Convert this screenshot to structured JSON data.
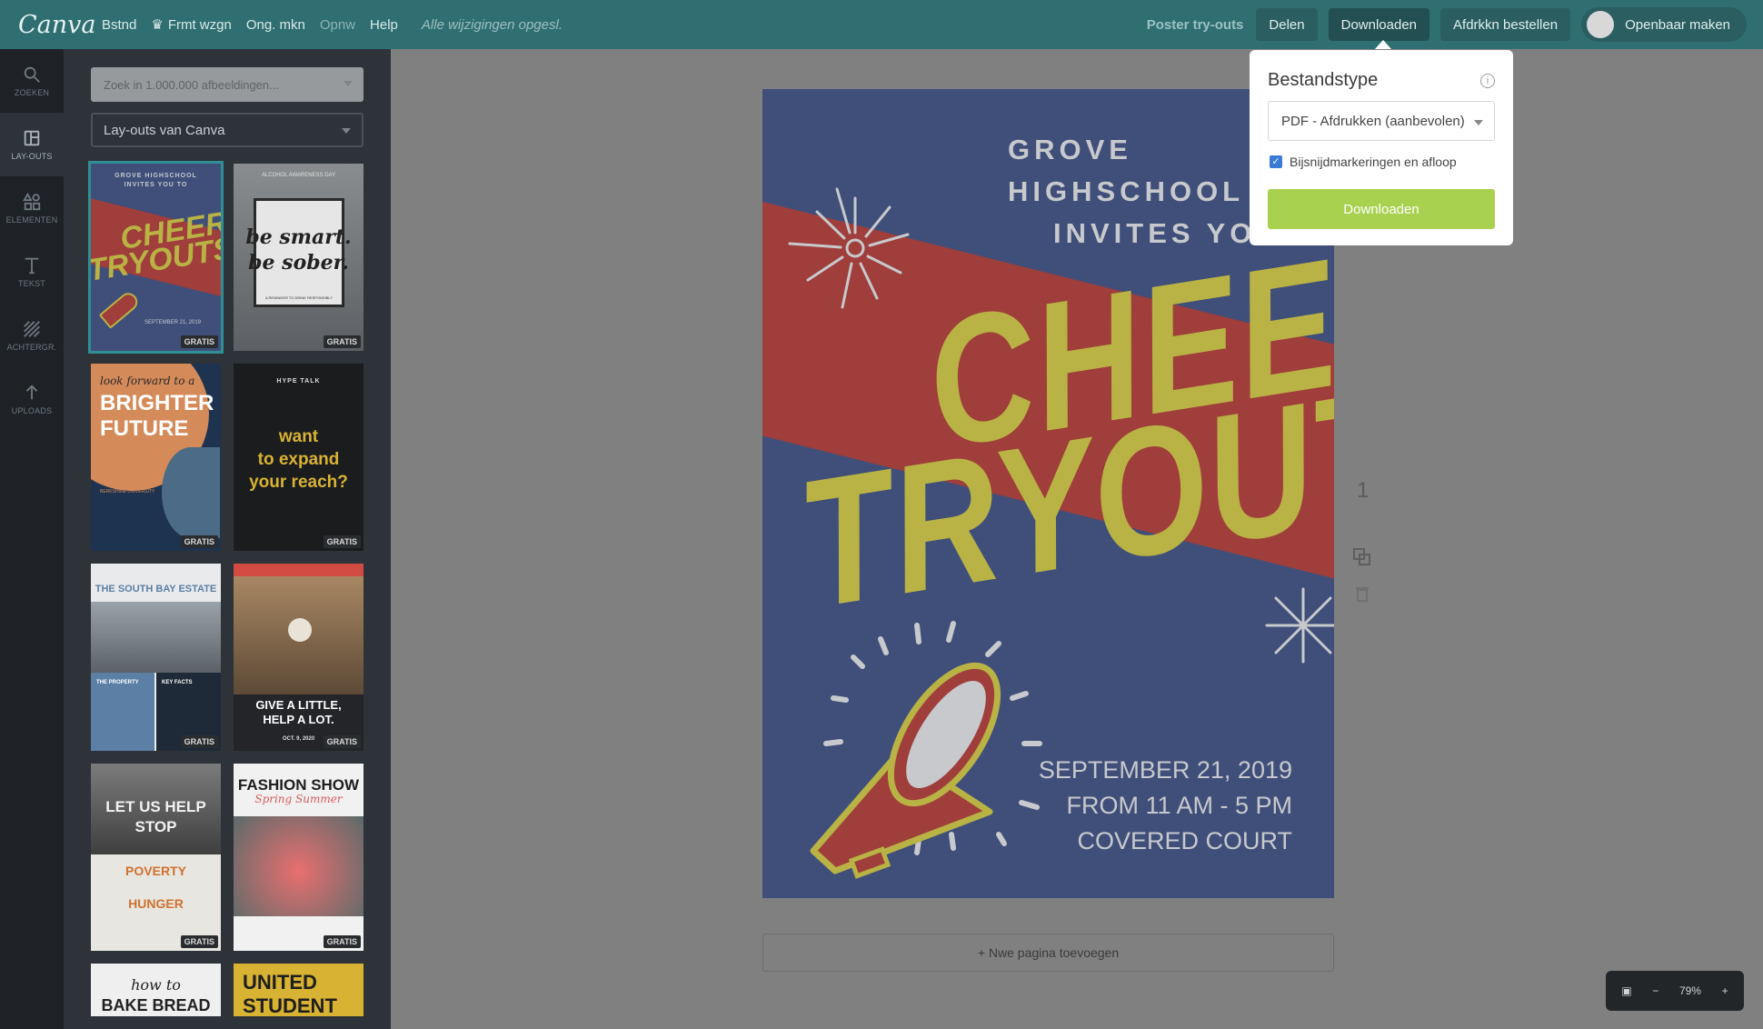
{
  "topbar": {
    "logo": "Canva",
    "menu": [
      "Bstnd",
      "Frmt wzgn",
      "Ong. mkn",
      "Opnw",
      "Help"
    ],
    "status": "Alle wijzigingen opgesl.",
    "doc_title": "Poster try-outs",
    "share": "Delen",
    "download": "Downloaden",
    "order_prints": "Afdrkkn bestellen",
    "make_public": "Openbaar maken"
  },
  "rail": [
    {
      "icon": "search-icon",
      "label": "ZOEKEN"
    },
    {
      "icon": "layouts-icon",
      "label": "LAY-OUTS"
    },
    {
      "icon": "elements-icon",
      "label": "ELEMENTEN"
    },
    {
      "icon": "text-icon",
      "label": "TEKST"
    },
    {
      "icon": "background-icon",
      "label": "ACHTERGR."
    },
    {
      "icon": "upload-icon",
      "label": "UPLOADS"
    }
  ],
  "panel": {
    "search_placeholder": "Zoek in 1.000.000 afbeeldingen...",
    "layout_source": "Lay-outs van Canva",
    "badge": "GRATIS",
    "thumbs": [
      {
        "lines": [
          "GROVE HIGHSCHOOL",
          "INVITES YOU TO",
          "CHEER",
          "TRYOUTS",
          "SEPTEMBER 21, 2019"
        ]
      },
      {
        "lines": [
          "ALCOHOL AWARENESS DAY",
          "be smart.",
          "be sober.",
          "A REMINDER TO DRINK RESPONSIBLY"
        ]
      },
      {
        "lines": [
          "look forward to a",
          "BRIGHTER",
          "FUTURE",
          "BERKSHIRE UNIVERSITY"
        ]
      },
      {
        "lines": [
          "HYPE TALK",
          "want",
          "to expand",
          "your reach?"
        ]
      },
      {
        "lines": [
          "THE SOUTH BAY ESTATE",
          "THE PROPERTY",
          "KEY FACTS"
        ]
      },
      {
        "lines": [
          "GIVE A LITTLE,",
          "HELP A LOT.",
          "OCT. 9, 2020"
        ]
      },
      {
        "lines": [
          "LET US HELP",
          "STOP",
          "POVERTY",
          "HUNGER"
        ]
      },
      {
        "lines": [
          "FASHION SHOW",
          "Spring Summer"
        ]
      },
      {
        "lines": [
          "how to",
          "BAKE BREAD"
        ]
      },
      {
        "lines": [
          "UNITED",
          "STUDENT"
        ]
      }
    ]
  },
  "poster": {
    "school_line1": "GROVE HIGHSCHOOL",
    "school_line2": "INVITES YOU TO",
    "word1": "CHEER",
    "word2": "TRYOUTS",
    "date": "SEPTEMBER 21, 2019",
    "time": "FROM 11 AM - 5 PM",
    "place": "COVERED COURT"
  },
  "canvas": {
    "page_number": "1",
    "add_page": "+ Nwe pagina toevoegen",
    "zoom": "79%"
  },
  "download_popover": {
    "title": "Bestandstype",
    "file_type": "PDF - Afdrukken (aanbevolen)",
    "option_label": "Bijsnijdmarkeringen en afloop",
    "option_checked": true,
    "button": "Downloaden"
  },
  "colors": {
    "topbar": "#2f6f72",
    "poster_blue": "#3f4f7a",
    "poster_red": "#9f3e3b",
    "poster_yellow": "#b9b244",
    "download_green": "#a8d150"
  }
}
